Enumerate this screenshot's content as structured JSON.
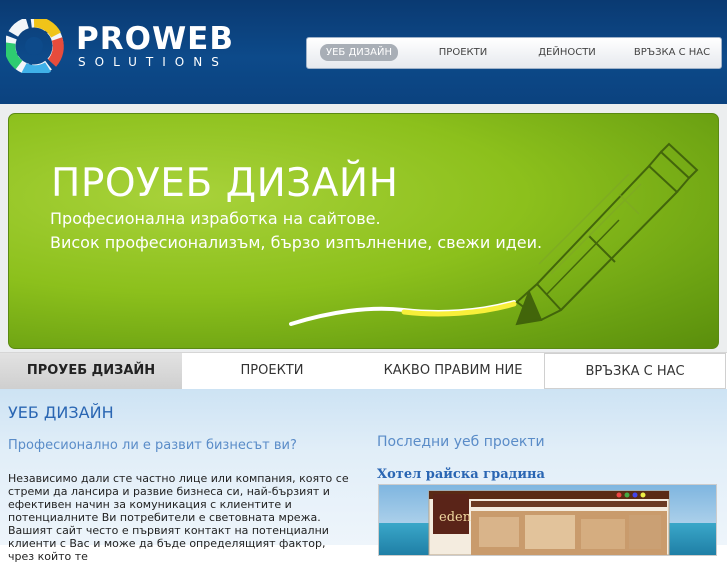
{
  "logo": {
    "title": "PROWEB",
    "subtitle": "SOLUTIONS"
  },
  "topnav": {
    "items": [
      "УЕБ ДИЗАЙН",
      "ПРОЕКТИ",
      "ДЕЙНОСТИ",
      "ВРЪЗКА С НАС"
    ],
    "active_index": 0
  },
  "banner": {
    "title": "ПРОУЕБ ДИЗАЙН",
    "line1": "Професионална изработка на сайтове.",
    "line2": "Висок професионализъм, бързо изпълнение, свежи идеи."
  },
  "tabs": {
    "items": [
      "ПРОУЕБ ДИЗАЙН",
      "ПРОЕКТИ",
      "КАКВО ПРАВИМ НИЕ",
      "ВРЪЗКА С НАС"
    ],
    "active_index": 0
  },
  "content": {
    "title": "УЕБ ДИЗАЙН",
    "question": "Професионално ли е развит бизнесът ви?",
    "paragraph": "Независимо дали сте частно лице или компания, която се стреми да лансира и развие бизнеса си, най-бързият и ефективен начин за комуникация с клиентите и потенциалните Ви потребители е световната мрежа. Вашият сайт често е първият контакт на потенциални клиенти с Вас и може да бъде определящият фактор, чрез който те"
  },
  "recent": {
    "title": "Последни уеб проекти",
    "project_name": "Хотел райска градина",
    "thumb_brand": "eden"
  },
  "colors": {
    "header": "#0d4a8a",
    "banner_green": "#8cc01c",
    "link_blue": "#2a66b3",
    "content_bg": "#e1eef8"
  }
}
